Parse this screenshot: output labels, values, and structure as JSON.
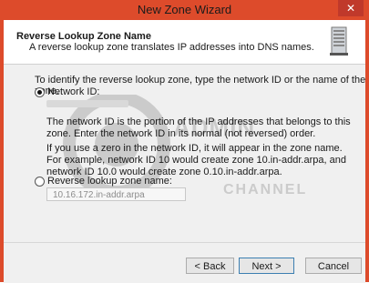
{
  "window": {
    "title": "New Zone Wizard",
    "close_glyph": "✕"
  },
  "header": {
    "title": "Reverse Lookup Zone Name",
    "subtitle": "A reverse lookup zone translates IP addresses into DNS names.",
    "icon": "server-icon"
  },
  "content": {
    "intro": "To identify the reverse lookup zone, type the network ID or the name of the zone.",
    "network_id_option": {
      "label": "Network ID:",
      "selected": true
    },
    "help_1": "The network ID is the portion of the IP addresses that belongs to this zone. Enter the network ID in its normal (not reversed) order.",
    "help_2": "If you use a zero in the network ID, it will appear in the zone name. For example, network ID 10 would create zone 10.in-addr.arpa, and network ID 10.0 would create zone 0.10.in-addr.arpa.",
    "reverse_zone_option": {
      "label": "Reverse lookup zone name:",
      "selected": false
    },
    "reverse_zone_value": "10.16.172.in-addr.arpa"
  },
  "watermark": {
    "line1": "ADMIN",
    "line2": "CHANNEL"
  },
  "footer": {
    "back_label": "< Back",
    "next_label": "Next >",
    "cancel_label": "Cancel"
  }
}
